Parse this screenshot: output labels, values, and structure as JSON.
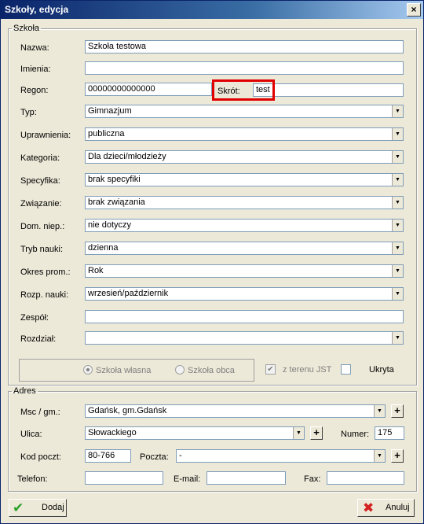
{
  "window": {
    "title": "Szkoły, edycja",
    "close_glyph": "×"
  },
  "szkola": {
    "legend": "Szkoła",
    "nazwa": {
      "label": "Nazwa:",
      "value": "Szkoła testowa"
    },
    "imienia": {
      "label": "Imienia:",
      "value": ""
    },
    "regon": {
      "label": "Regon:",
      "value": "00000000000000"
    },
    "skrot": {
      "label": "Skrót:",
      "value": "test"
    },
    "typ": {
      "label": "Typ:",
      "value": "Gimnazjum"
    },
    "uprawnienia": {
      "label": "Uprawnienia:",
      "value": "publiczna"
    },
    "kategoria": {
      "label": "Kategoria:",
      "value": "Dla dzieci/młodzieży"
    },
    "specyfika": {
      "label": "Specyfika:",
      "value": "brak specyfiki"
    },
    "zwiazanie": {
      "label": "Związanie:",
      "value": "brak związania"
    },
    "dom_niep": {
      "label": "Dom. niep.:",
      "value": "nie dotyczy"
    },
    "tryb_nauki": {
      "label": "Tryb nauki:",
      "value": "dzienna"
    },
    "okres_prom": {
      "label": "Okres prom.:",
      "value": "Rok"
    },
    "rozp_nauki": {
      "label": "Rozp. nauki:",
      "value": "wrzesień/październik"
    },
    "zespol": {
      "label": "Zespół:",
      "value": ""
    },
    "rozdzial": {
      "label": "Rozdział:",
      "value": ""
    },
    "radio_wlasna": "Szkoła własna",
    "radio_obca": "Szkoła obca",
    "z_terenu_jst": "z terenu JST",
    "ukryta": "Ukryta"
  },
  "adres": {
    "legend": "Adres",
    "msc": {
      "label": "Msc / gm.:",
      "value": "Gdańsk, gm.Gdańsk"
    },
    "ulica": {
      "label": "Ulica:",
      "value": "Słowackiego"
    },
    "numer": {
      "label": "Numer:",
      "value": "175"
    },
    "kod": {
      "label": "Kod poczt:",
      "value": "80-766"
    },
    "poczta": {
      "label": "Poczta:",
      "value": "-"
    },
    "telefon": {
      "label": "Telefon:",
      "value": ""
    },
    "email": {
      "label": "E-mail:",
      "value": ""
    },
    "fax": {
      "label": "Fax:",
      "value": ""
    }
  },
  "buttons": {
    "dodaj": "Dodaj",
    "anuluj": "Anuluj"
  },
  "icons": {
    "plus": "+",
    "dropdown": "▼",
    "check": "✔",
    "cross": "✖"
  },
  "colors": {
    "highlight": "#e00000",
    "check_green": "#2aa02a",
    "cross_red": "#d42020"
  }
}
